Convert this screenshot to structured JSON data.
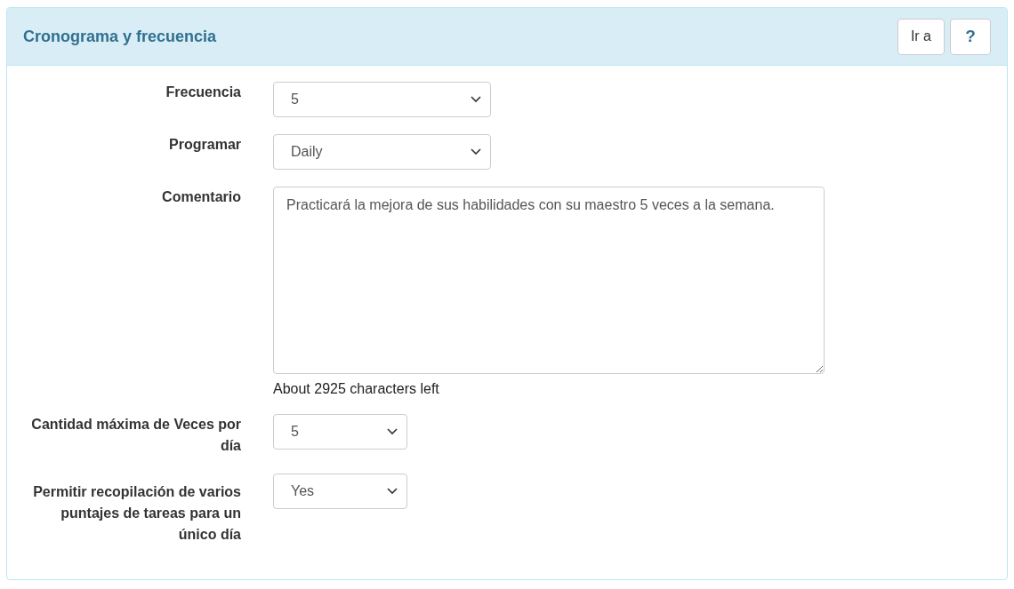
{
  "panel": {
    "title": "Cronograma y frecuencia",
    "buttons": [
      {
        "kind": "text",
        "label": "Ir a"
      },
      {
        "kind": "help",
        "label": "?"
      }
    ]
  },
  "fields": [
    {
      "kind": "select",
      "label": "Frecuencia",
      "value": "5"
    },
    {
      "kind": "select",
      "label": "Programar",
      "value": "Daily"
    },
    {
      "kind": "textarea",
      "label": "Comentario",
      "value": "Practicará la mejora de sus habilidades con su maestro 5 veces a la semana.",
      "hint": "About 2925 characters left"
    },
    {
      "kind": "short_select",
      "label": "Cantidad máxima de Veces por día",
      "value": "5"
    },
    {
      "kind": "short_select",
      "label": "Permitir recopilación de varios puntajes de tareas para un único día",
      "value": "Yes"
    }
  ]
}
